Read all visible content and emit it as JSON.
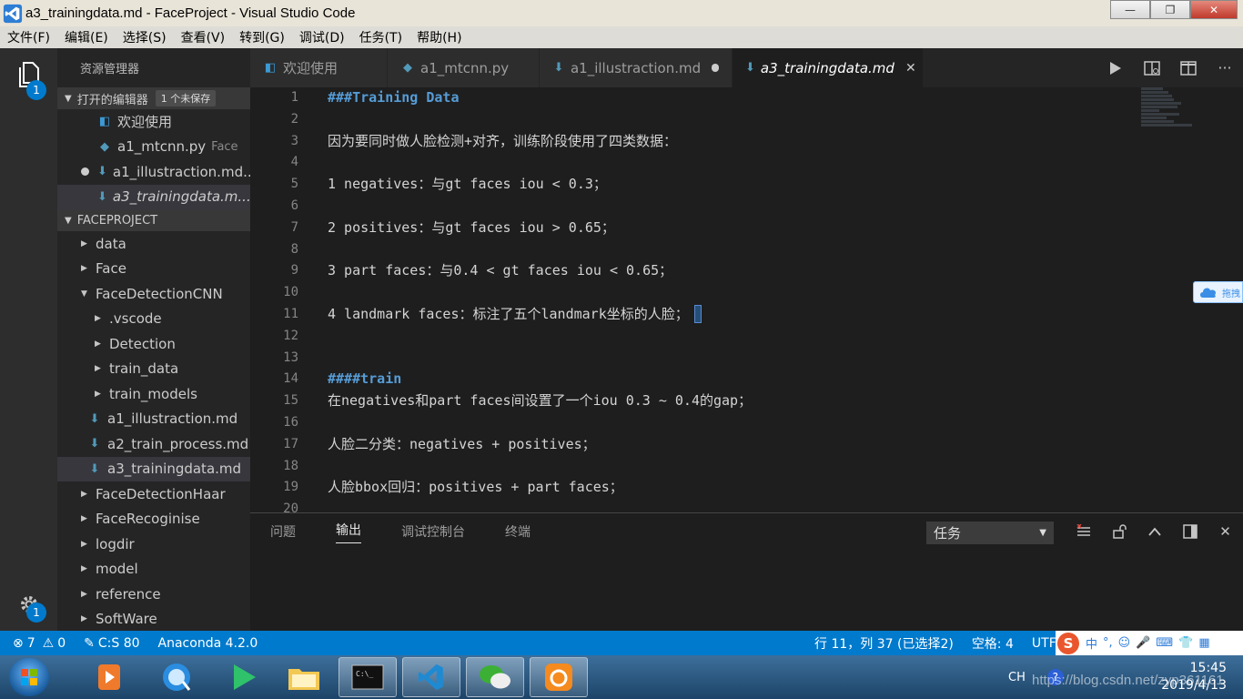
{
  "window": {
    "title": "a3_trainingdata.md - FaceProject - Visual Studio Code",
    "minimize": "—",
    "maximize": "❐",
    "close": "✕"
  },
  "menu": [
    "文件(F)",
    "编辑(E)",
    "选择(S)",
    "查看(V)",
    "转到(G)",
    "调试(D)",
    "任务(T)",
    "帮助(H)"
  ],
  "activity": {
    "explorer_badge": "1",
    "settings_badge": "1"
  },
  "sidebar": {
    "title": "资源管理器",
    "open_editors": {
      "label": "打开的编辑器",
      "unsaved": "1 个未保存",
      "items": [
        {
          "name": "欢迎使用",
          "desc": ""
        },
        {
          "name": "a1_mtcnn.py",
          "desc": "Face"
        },
        {
          "name": "a1_illustraction.md...",
          "desc": ""
        },
        {
          "name": "a3_trainingdata.m...",
          "desc": ""
        }
      ]
    },
    "project": {
      "label": "FACEPROJECT",
      "items": [
        {
          "name": "data"
        },
        {
          "name": "Face"
        },
        {
          "name": "FaceDetectionCNN"
        },
        {
          "name": ".vscode"
        },
        {
          "name": "Detection"
        },
        {
          "name": "train_data"
        },
        {
          "name": "train_models"
        },
        {
          "name": "a1_illustraction.md"
        },
        {
          "name": "a2_train_process.md"
        },
        {
          "name": "a3_trainingdata.md"
        },
        {
          "name": "FaceDetectionHaar"
        },
        {
          "name": "FaceRecoginise"
        },
        {
          "name": "logdir"
        },
        {
          "name": "model"
        },
        {
          "name": "reference"
        },
        {
          "name": "SoftWare"
        }
      ]
    }
  },
  "tabs": [
    {
      "label": "欢迎使用"
    },
    {
      "label": "a1_mtcnn.py"
    },
    {
      "label": "a1_illustraction.md"
    },
    {
      "label": "a3_trainingdata.md"
    }
  ],
  "editor": {
    "line_numbers": [
      "1",
      "2",
      "3",
      "4",
      "5",
      "6",
      "7",
      "8",
      "9",
      "10",
      "11",
      "12",
      "13",
      "14",
      "15",
      "16",
      "17",
      "18",
      "19",
      "20"
    ],
    "lines": [
      "###Training Data",
      "",
      "因为要同时做人脸检测+对齐，训练阶段使用了四类数据：",
      "",
      "1 negatives：与gt faces iou < 0.3；",
      "",
      "2 positives：与gt faces iou > 0.65；",
      "",
      "3 part faces：与0.4 < gt faces iou < 0.65；",
      "",
      "4 landmark faces：标注了五个landmark坐标的人脸；",
      "",
      "",
      "####train",
      "在negatives和part faces间设置了一个iou 0.3 ~ 0.4的gap；",
      "",
      "人脸二分类：negatives + positives；",
      "",
      "人脸bbox回归：positives + part faces；",
      ""
    ]
  },
  "floating_widget": {
    "text": "拖拽"
  },
  "panel": {
    "tabs": [
      "问题",
      "输出",
      "调试控制台",
      "终端"
    ],
    "select_value": "任务"
  },
  "status": {
    "errors": "7",
    "warnings": "0",
    "cs": "C:S 80",
    "env": "Anaconda 4.2.0",
    "position": "行 11，列 37 (已选择2)",
    "spaces": "空格: 4",
    "encoding": "UTF-"
  },
  "ime": {
    "logo": "S",
    "mode": "中",
    "punct": "°,",
    "face": "☺",
    "mic": "🎤",
    "kbd": "⌨",
    "skin": "👕",
    "grid": "▦"
  },
  "tray": {
    "lang": "CH",
    "help": "?",
    "time": "15:45",
    "date": "2019/4/13",
    "watermark": "https://blog.csdn.net/zyp361161"
  },
  "colors": {
    "statusbar": "#007acc",
    "heading": "#569cd6",
    "editor_bg": "#1e1e1e"
  }
}
